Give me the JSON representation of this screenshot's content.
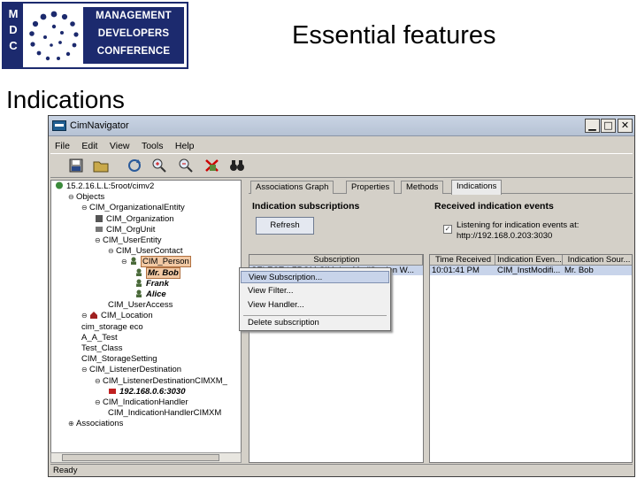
{
  "logo": {
    "side_letters": [
      "M",
      "D",
      "C"
    ],
    "lines": [
      "MANAGEMENT",
      "DEVELOPERS",
      "CONFERENCE"
    ]
  },
  "slide": {
    "title": "Essential features",
    "subtitle": "Indications"
  },
  "window": {
    "title": "CimNavigator",
    "controls": {
      "minimize": "▁",
      "maximize": "□",
      "close": "✕"
    }
  },
  "menu": [
    "File",
    "Edit",
    "View",
    "Tools",
    "Help"
  ],
  "toolbar": [
    {
      "icon": "save-icon"
    },
    {
      "icon": "folder-icon"
    },
    {
      "icon": "refresh-icon"
    },
    {
      "icon": "zoom-in-icon"
    },
    {
      "icon": "zoom-out-icon"
    },
    {
      "icon": "delete-icon"
    },
    {
      "icon": "binoculars-icon"
    }
  ],
  "tree": [
    {
      "label": "15.2.16.L.L:5root/cimv2",
      "toggle": "",
      "icon": "globe-icon",
      "indent": 0
    },
    {
      "label": "Objects",
      "toggle": "⊖",
      "icon": "",
      "indent": 1
    },
    {
      "label": "CIM_OrganizationalEntity",
      "toggle": "⊖",
      "icon": "",
      "indent": 2
    },
    {
      "label": "CIM_Organization",
      "toggle": "",
      "icon": "building-icon",
      "indent": 3
    },
    {
      "label": "CIM_OrgUnit",
      "toggle": "",
      "icon": "orgunit-icon",
      "indent": 3
    },
    {
      "label": "CIM_UserEntity",
      "toggle": "⊖",
      "icon": "",
      "indent": 3
    },
    {
      "label": "CIM_UserContact",
      "toggle": "⊖",
      "icon": "",
      "indent": 4
    },
    {
      "label": "CIM_Person",
      "toggle": "⊖",
      "icon": "person-icon",
      "indent": 5,
      "selected": true
    },
    {
      "label": "Mr. Bob",
      "toggle": "",
      "icon": "person-icon",
      "indent": 6,
      "bold": true,
      "selected": true
    },
    {
      "label": "Frank",
      "toggle": "",
      "icon": "person-icon",
      "indent": 6,
      "bold": true
    },
    {
      "label": "Alice",
      "toggle": "",
      "icon": "person-icon",
      "indent": 6,
      "bold": true
    },
    {
      "label": "CIM_UserAccess",
      "toggle": "",
      "icon": "",
      "indent": 4
    },
    {
      "label": "CIM_Location",
      "toggle": "⊖",
      "icon": "house-icon",
      "indent": 2
    },
    {
      "label": "cim_storage eco",
      "toggle": "",
      "icon": "",
      "indent": 2
    },
    {
      "label": "A_A_Test",
      "toggle": "",
      "icon": "",
      "indent": 2
    },
    {
      "label": "Test_Class",
      "toggle": "",
      "icon": "",
      "indent": 2
    },
    {
      "label": "CIM_StorageSetting",
      "toggle": "",
      "icon": "",
      "indent": 2
    },
    {
      "label": "CIM_ListenerDestination",
      "toggle": "⊖",
      "icon": "",
      "indent": 2
    },
    {
      "label": "CIM_ListenerDestinationCIMXM_",
      "toggle": "⊖",
      "icon": "",
      "indent": 3
    },
    {
      "label": "192.168.0.6:3030",
      "toggle": "",
      "icon": "red-server-icon",
      "indent": 4,
      "bold": true
    },
    {
      "label": "CIM_IndicationHandler",
      "toggle": "⊖",
      "icon": "",
      "indent": 3
    },
    {
      "label": "CIM_IndicationHandlerCIMXM",
      "toggle": "",
      "icon": "",
      "indent": 4
    },
    {
      "label": "Associations",
      "toggle": "⊕",
      "icon": "",
      "indent": 1
    }
  ],
  "tabs": [
    {
      "label": "Associations Graph",
      "active": false
    },
    {
      "label": "Properties",
      "active": false
    },
    {
      "label": "Methods",
      "active": false
    },
    {
      "label": "Indications",
      "active": true
    }
  ],
  "subscriptions": {
    "heading": "Indication subscriptions",
    "refresh_label": "Refresh",
    "column": "Subscription",
    "row": [
      "SELECT * FROM CIM_InstModification W..."
    ]
  },
  "received": {
    "heading": "Received indication events",
    "listening_line1": "Listening for indication events at:",
    "listening_line2": "http://192.168.0.203:3030",
    "checkbox_checked": true,
    "columns": [
      "Time Received",
      "Indication Even...",
      "Indication Sour..."
    ],
    "row": [
      "10:01:41 PM",
      "CIM_InstModifi...",
      "Mr. Bob"
    ]
  },
  "context_menu": [
    {
      "label": "View Subscription...",
      "highlighted": true
    },
    {
      "label": "View Filter...",
      "highlighted": false
    },
    {
      "label": "View Handler...",
      "highlighted": false
    },
    {
      "label": "Delete subscription",
      "highlighted": false
    }
  ],
  "status": "Ready",
  "colors": {
    "brand_navy": "#1c2a6e",
    "selection": "#c8d4ea",
    "tree_selection": "#f2c9a4"
  }
}
